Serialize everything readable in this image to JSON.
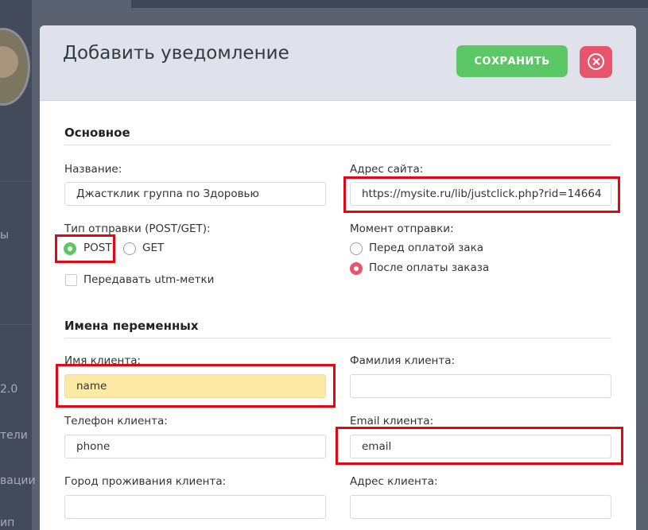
{
  "background": {
    "sidebar_items": [
      "ы",
      "2.0",
      "тели",
      "вации",
      "ип"
    ]
  },
  "modal": {
    "title": "Добавить уведомление",
    "save_label": "СОХРАНИТЬ",
    "close_icon": "close-circle-icon"
  },
  "basic": {
    "section_title": "Основное",
    "name_label": "Название:",
    "name_value": "Джастклик группа по Здоровью",
    "url_label": "Адрес сайта:",
    "url_value": "https://mysite.ru/lib/justclick.php?rid=14664",
    "send_type_label": "Тип отправки (POST/GET):",
    "send_type_options": [
      "POST",
      "GET"
    ],
    "send_type_selected": "POST",
    "utm_label": "Передавать utm-метки",
    "utm_checked": false,
    "moment_label": "Момент отправки:",
    "moment_options": [
      "Перед оплатой зака",
      "После оплаты заказа"
    ],
    "moment_selected": "После оплаты заказа"
  },
  "variables": {
    "section_title": "Имена переменных",
    "client_name_label": "Имя клиента:",
    "client_name_value": "name",
    "client_surname_label": "Фамилия клиента:",
    "client_surname_value": "",
    "client_phone_label": "Телефон клиента:",
    "client_phone_value": "phone",
    "client_email_label": "Email клиента:",
    "client_email_value": "email",
    "client_city_label": "Город проживания клиента:",
    "client_city_value": "",
    "client_address_label": "Адрес клиента:",
    "client_address_value": ""
  },
  "colors": {
    "save_green": "#5bc765",
    "close_red": "#e7546b",
    "highlight_red": "#e30613",
    "name_field_yellow": "#fbe9a4"
  }
}
